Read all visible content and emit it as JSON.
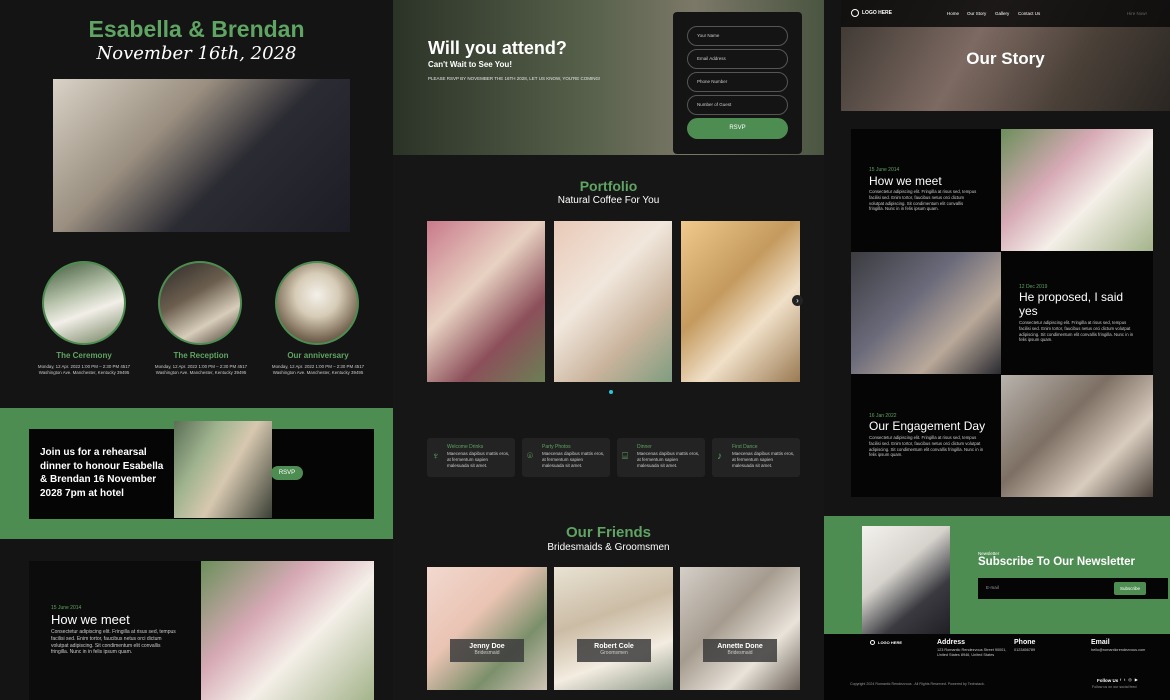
{
  "left": {
    "couple": "Esabella & Brendan",
    "date": "November 16th, 2028",
    "events": [
      {
        "title": "The Ceremony",
        "text": "Monday, 12 Apr. 2022 1:00 PM – 2:30 PM 4517 Washington Ave. Manchester, Kentucky 39495"
      },
      {
        "title": "The Reception",
        "text": "Monday, 12 Apr. 2022 1:00 PM – 2:30 PM 4517 Washington Ave. Manchester, Kentucky 39495"
      },
      {
        "title": "Our anniversary",
        "text": "Monday, 12 Apr. 2022 1:00 PM – 2:30 PM 4517 Washington Ave. Manchester, Kentucky 39495"
      }
    ],
    "rehearsal_text": "Join us for a rehearsal dinner to honour Esabella & Brendan 16 November 2028 7pm at hotel",
    "rehearsal_button": "RSVP",
    "story": {
      "date": "15 June 2014",
      "title": "How we meet",
      "text": "Consectetur adipiscing elit. Fringilla at risus sed, tempus facilisi sed. Enim tortor, faucibus netus orci dictum volutpat adipiscing. Sit condimentum elit convallis fringilla. Nunc in in felis ipsum quam."
    }
  },
  "middle": {
    "rsvp": {
      "heading": "Will you attend?",
      "subheading": "Can't Wait to See You!",
      "note": "PLEASE RSVP BY NOVEMBER THE 16TH 2028, LET US KNOW, YOU'RE COMING!",
      "fields": [
        "Your Name",
        "Email Address",
        "Phone Number",
        "Number of Guest"
      ],
      "button": "RSVP"
    },
    "portfolio": {
      "title": "Portfolio",
      "subtitle": "Natural Coffee For You"
    },
    "features": [
      {
        "title": "Welcome Drinks",
        "text": "Maecenas dapibus mattis eros, at fermentum sapien malesuada sit amet.",
        "icon": "glass-icon"
      },
      {
        "title": "Party Photos",
        "text": "Maecenas dapibus mattis eros, at fermentum sapien malesuada sit amet.",
        "icon": "camera-icon"
      },
      {
        "title": "Dinner",
        "text": "Maecenas dapibus mattis eros, at fermentum sapien malesuada sit amet.",
        "icon": "dinner-icon"
      },
      {
        "title": "First Dance",
        "text": "Maecenas dapibus mattis eros, at fermentum sapien malesuada sit amet.",
        "icon": "dance-icon"
      }
    ],
    "friends": {
      "title": "Our Friends",
      "subtitle": "Bridesmaids & Groomsmen",
      "people": [
        {
          "name": "Jenny Doe",
          "role": "Bridesmaid"
        },
        {
          "name": "Robert Cole",
          "role": "Groomsmen"
        },
        {
          "name": "Annette Done",
          "role": "Bridesmaid"
        }
      ]
    }
  },
  "right": {
    "nav": {
      "logo": "LOGO HERE",
      "items": [
        "Home",
        "Our Story",
        "Gallery",
        "Contact Us"
      ],
      "extra": "Hire Now!"
    },
    "hero_title": "Our Story",
    "stories": [
      {
        "date": "15 June 2014",
        "title": "How we meet",
        "text": "Consectetur adipiscing elit. Fringilla at risus sed, tempus facilisi sed. Enim tortor, faucibus netus orci dictum volutpat adipiscing. Sit condimentum elit convallis fringilla. Nunc in in felis ipsum quam."
      },
      {
        "date": "12 Dec 2019",
        "title": "He proposed, I said yes",
        "text": "Consectetur adipiscing elit. Fringilla at risus sed, tempus facilisi sed. Enim tortor, faucibus netus orci dictum volutpat adipiscing. Sit condimentum elit convallis fringilla. Nunc in in felis ipsum quam."
      },
      {
        "date": "16 Jan 2022",
        "title": "Our Engagement Day",
        "text": "Consectetur adipiscing elit. Fringilla at risus sed, tempus facilisi sed. Enim tortor, faucibus netus orci dictum volutpat adipiscing. Sit condimentum elit convallis fringilla. Nunc in in felis ipsum quam."
      }
    ],
    "newsletter": {
      "label": "Newsletter",
      "title": "Subscribe To Our Newsletter",
      "placeholder": "E-mail",
      "button": "Subscribe"
    },
    "footer": {
      "logo": "LOGO HERE",
      "address_title": "Address",
      "address": "123 Romantic Rendezvous Street 90001, United States 8946, United States",
      "phone_title": "Phone",
      "phone": "0123456789",
      "email_title": "Email",
      "email": "hello@romanticrendezvous.com",
      "copyright": "Copyright 2024 Romantic Rendezvous . All Rights Reserved. Powered by Techstack.",
      "follow": "Follow Us",
      "follow_note": "Follow us on our social feed"
    }
  },
  "colors": {
    "accent": "#5fa463",
    "accent_bg": "#4e8d52",
    "page_bg": "#161616"
  }
}
